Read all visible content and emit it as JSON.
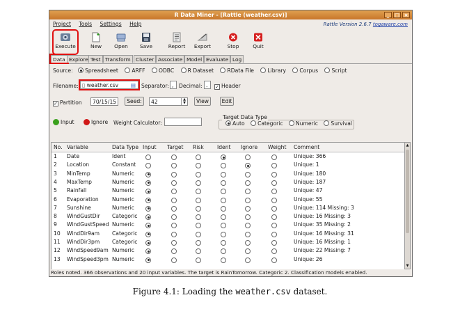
{
  "window": {
    "title": "R Data Miner - [Rattle (weather.csv)]",
    "controls": [
      "_",
      "□",
      "×"
    ]
  },
  "menu": {
    "items": [
      "Project",
      "Tools",
      "Settings",
      "Help"
    ],
    "version_prefix": "Rattle Version 2.6.7 ",
    "version_link": "togaware.com"
  },
  "toolbar": {
    "execute": "Execute",
    "new": "New",
    "open": "Open",
    "save": "Save",
    "report": "Report",
    "export": "Export",
    "stop": "Stop",
    "quit": "Quit"
  },
  "tabs": [
    "Data",
    "Explore",
    "Test",
    "Transform",
    "Cluster",
    "Associate",
    "Model",
    "Evaluate",
    "Log"
  ],
  "source": {
    "label": "Source:",
    "options": [
      "Spreadsheet",
      "ARFF",
      "ODBC",
      "R Dataset",
      "RData File",
      "Library",
      "Corpus",
      "Script"
    ],
    "selected": "Spreadsheet"
  },
  "file": {
    "filename_label": "Filename:",
    "filename": "weather.csv",
    "separator_label": "Separator:",
    "separator": ",",
    "decimal_label": "Decimal:",
    "decimal": ".",
    "header_label": "Header"
  },
  "partition": {
    "label": "Partition",
    "value": "70/15/15",
    "seed_button": "Seed:",
    "seed": "42",
    "view": "View",
    "edit": "Edit"
  },
  "roles": {
    "input": "Input",
    "ignore": "Ignore",
    "weight_label": "Weight Calculator:"
  },
  "target_type": {
    "title": "Target Data Type",
    "options": [
      "Auto",
      "Categoric",
      "Numeric",
      "Survival"
    ],
    "selected": "Auto"
  },
  "grid": {
    "headers": [
      "No.",
      "Variable",
      "Data Type",
      "Input",
      "Target",
      "Risk",
      "Ident",
      "Ignore",
      "Weight",
      "Comment"
    ],
    "rows": [
      {
        "no": "1",
        "var": "Date",
        "type": "Ident",
        "role": "ident",
        "comment": "Unique: 366"
      },
      {
        "no": "2",
        "var": "Location",
        "type": "Constant",
        "role": "ignore",
        "comment": "Unique: 1"
      },
      {
        "no": "3",
        "var": "MinTemp",
        "type": "Numeric",
        "role": "input",
        "comment": "Unique: 180"
      },
      {
        "no": "4",
        "var": "MaxTemp",
        "type": "Numeric",
        "role": "input",
        "comment": "Unique: 187"
      },
      {
        "no": "5",
        "var": "Rainfall",
        "type": "Numeric",
        "role": "input",
        "comment": "Unique: 47"
      },
      {
        "no": "6",
        "var": "Evaporation",
        "type": "Numeric",
        "role": "input",
        "comment": "Unique: 55"
      },
      {
        "no": "7",
        "var": "Sunshine",
        "type": "Numeric",
        "role": "input",
        "comment": "Unique: 114 Missing: 3"
      },
      {
        "no": "8",
        "var": "WindGustDir",
        "type": "Categoric",
        "role": "input",
        "comment": "Unique: 16 Missing: 3"
      },
      {
        "no": "9",
        "var": "WindGustSpeed",
        "type": "Numeric",
        "role": "input",
        "comment": "Unique: 35 Missing: 2"
      },
      {
        "no": "10",
        "var": "WindDir9am",
        "type": "Categoric",
        "role": "input",
        "comment": "Unique: 16 Missing: 31"
      },
      {
        "no": "11",
        "var": "WindDir3pm",
        "type": "Categoric",
        "role": "input",
        "comment": "Unique: 16 Missing: 1"
      },
      {
        "no": "12",
        "var": "WindSpeed9am",
        "type": "Numeric",
        "role": "input",
        "comment": "Unique: 22 Missing: 7"
      },
      {
        "no": "13",
        "var": "WindSpeed3pm",
        "type": "Numeric",
        "role": "input",
        "comment": "Unique: 26"
      }
    ]
  },
  "status": "Roles noted. 366 observations and 20 input variables. The target is RainTomorrow. Categoric 2. Classification models enabled.",
  "caption": {
    "prefix": "Figure 4.1: Loading the ",
    "file": "weather.csv",
    "suffix": " dataset."
  },
  "colors": {
    "titlebar": "#d2832f",
    "highlight": "#e01010",
    "input_dot": "#3aa01c",
    "ignore_dot": "#d01818",
    "link": "#1e3fa8"
  }
}
